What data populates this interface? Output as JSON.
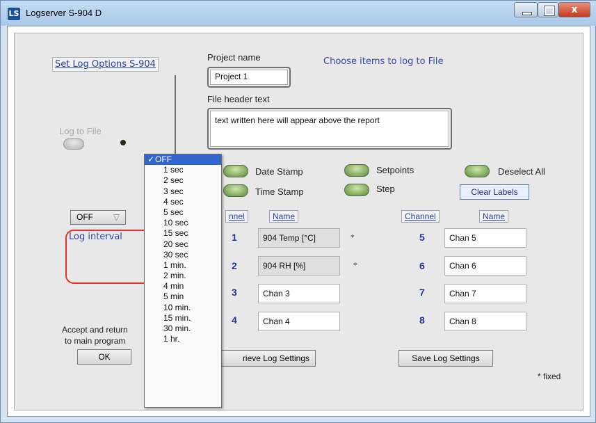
{
  "window": {
    "title": "Logserver S-904 D",
    "app_icon": "LS",
    "close_glyph": "x",
    "min_glyph": "minimize-icon",
    "max_glyph": "maximize-icon"
  },
  "left_panel": {
    "set_log_options": "Set Log Options S-904",
    "log_to_file_label": "Log to File",
    "interval_value": "OFF",
    "interval_arrow": "▽",
    "log_interval_label": "Log interval",
    "accept_text_line1": "Accept and return",
    "accept_text_line2": "to main program",
    "ok_label": "OK"
  },
  "project": {
    "name_label": "Project name",
    "name_value": "Project 1",
    "header_label": "File header text",
    "header_value": "text written here will appear above the report",
    "choose_items": "Choose items to log to File"
  },
  "options": {
    "date_stamp": "Date Stamp",
    "time_stamp": "Time Stamp",
    "setpoints": "Setpoints",
    "step": "Step",
    "deselect_all": "Deselect All",
    "clear_labels": "Clear Labels"
  },
  "channels": {
    "channel_header": "Channel",
    "channel_header_partial": "nnel",
    "name_header": "Name",
    "left": [
      {
        "num": "1",
        "name": "904 Temp [°C]",
        "fixed": true,
        "star": "*"
      },
      {
        "num": "2",
        "name": "904 RH [%]",
        "fixed": true,
        "star": "*"
      },
      {
        "num": "3",
        "name": "Chan 3",
        "fixed": false,
        "star": ""
      },
      {
        "num": "4",
        "name": "Chan 4",
        "fixed": false,
        "star": ""
      }
    ],
    "right": [
      {
        "num": "5",
        "name": "Chan 5"
      },
      {
        "num": "6",
        "name": "Chan 6"
      },
      {
        "num": "7",
        "name": "Chan 7"
      },
      {
        "num": "8",
        "name": "Chan 8"
      }
    ]
  },
  "buttons": {
    "retrieve_partial": "rieve Log Settings",
    "save": "Save Log Settings",
    "fixed_note": "* fixed"
  },
  "interval_menu": {
    "check": "✓",
    "items": [
      "OFF",
      "1 sec",
      "2 sec",
      "3 sec",
      "4 sec",
      "5 sec",
      "10 sec",
      "15 sec",
      "20 sec",
      "30 sec",
      "1 min.",
      "2 min.",
      "4 min",
      "5 min",
      "10 min.",
      "15 min.",
      "30 min.",
      "1 hr."
    ]
  }
}
